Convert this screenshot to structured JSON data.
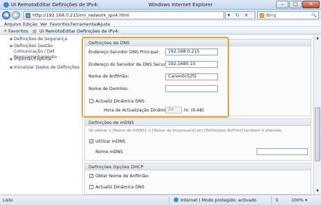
{
  "window": {
    "title": "UI RemotoEditar Definições de IPv4:",
    "app": "Windows Internet Explorer",
    "min": "–",
    "max": "□",
    "close": "✕"
  },
  "address": {
    "back": "◀",
    "forward": "▶",
    "url": "http://192.168.0.215/rm_network_ipv4.html",
    "refresh": "↻",
    "stop": "✕",
    "dropdown": "▾",
    "search_placeholder": "Bing",
    "search_icon": "🔍"
  },
  "menu": [
    "Arquivo",
    "Edição",
    "Ver",
    "Favoritos",
    "Ferramentas",
    "Ajuda"
  ],
  "favorites": {
    "label": "Favoritos",
    "tab": "UI RemotoEditar Definições de IPv4:"
  },
  "sidebar": {
    "items": [
      {
        "label": "Definições de Segurança"
      },
      {
        "label": "Definições Gestão Comunicação / Def. Reencaminhamento"
      },
      {
        "label": "Importar/Exportar"
      },
      {
        "label": "Inicializar Dados de Definições"
      }
    ]
  },
  "dns": {
    "title": "Definições de DNS",
    "primary_label": "Endereço Servidor DNS Principal:",
    "primary_value": "192.168.0.215",
    "secondary_label": "Endereço do Servidor de DNS Secundário:",
    "secondary_value": "192.1680.10",
    "host_label": "Nome de Anfitrião:",
    "host_value": "Canon0c52f2",
    "domain_label": "Nome de Domínio:",
    "domain_value": "",
    "dynamic_label": "Actualiz.Dinâmica DNS",
    "dynamic_checked": false,
    "interval_label": "Hora de Actualização Dinâmica DNS:",
    "interval_value": "24",
    "interval_unit": "hr.  (0-48)"
  },
  "mdns": {
    "title": "Definições de mDNS",
    "note": "Se alterar o [Nome de mDNS], o [Nome da Impressora] em [Definições AirPrint] também é alterado.",
    "use_label": "Utilizar mDNS",
    "use_checked": true,
    "name_label": "Nome mDNS",
    "name_value": ""
  },
  "dhcp": {
    "title": "Definições Opções DHCP",
    "host_label": "Obter Nome de Anfitrião:",
    "host_checked": true,
    "dns_label": "Actualiz.Dinâmica DNS",
    "dns_checked": false
  },
  "status": {
    "left": "Listo",
    "zone": "Internet | Modo protegido: activado",
    "zoom": "100%",
    "zoom_arrow": "▾",
    "security": "⚲"
  },
  "scroll": {
    "up": "▲",
    "down": "▼"
  },
  "check_mark": "✓"
}
